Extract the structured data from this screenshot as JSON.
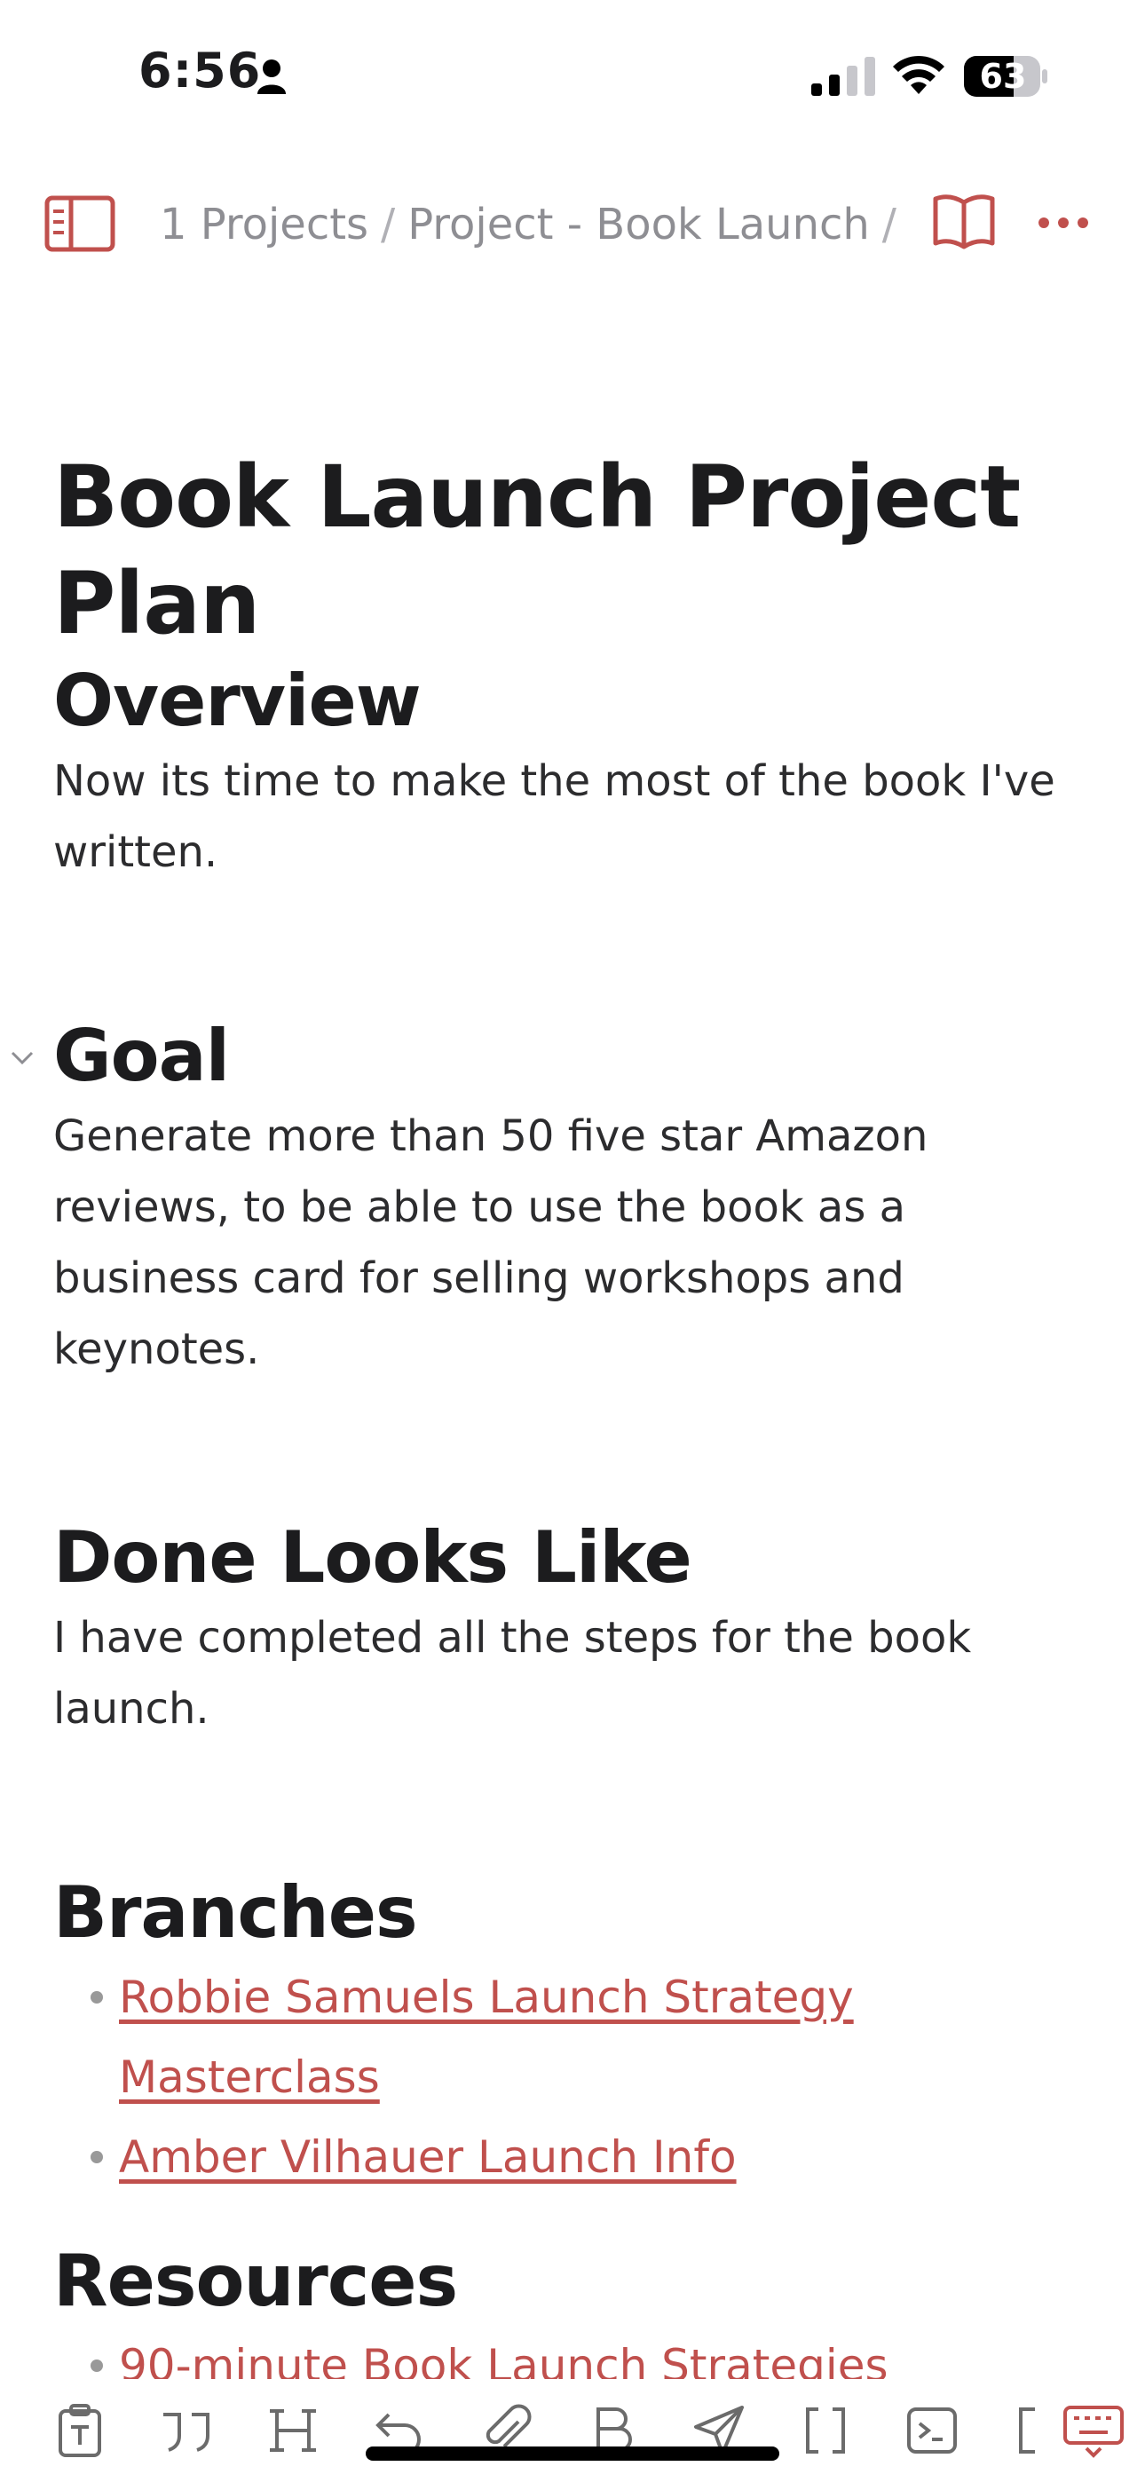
{
  "status_bar": {
    "time": "6:56",
    "battery": "63"
  },
  "toolbar": {
    "breadcrumb": [
      "1 Projects",
      "Project - Book Launch",
      "_"
    ]
  },
  "document": {
    "title": "Book Launch Project Plan",
    "sections": [
      {
        "heading": "Overview",
        "body": "Now its time to make the most of the book I've written."
      },
      {
        "heading": "Goal",
        "body": "Generate more than 50 five star Amazon reviews, to be able to use the book as a business card for selling workshops and keynotes."
      },
      {
        "heading": "Done Looks Like",
        "body": "I have completed all the steps for the book launch."
      },
      {
        "heading": "Branches",
        "links": [
          "Robbie Samuels Launch Strategy Masterclass",
          "Amber Vilhauer Launch Info"
        ]
      },
      {
        "heading": "Resources",
        "links": [
          "90-minute Book Launch Strategies"
        ]
      }
    ]
  },
  "colors": {
    "accent": "#c0504d",
    "text": "#1c1c1e",
    "muted": "#8e8e93"
  },
  "format_bar": {
    "icons": [
      "template-icon",
      "quote-icon",
      "heading-icon",
      "undo-icon",
      "attachment-icon",
      "bold-icon",
      "send-icon",
      "brackets-icon",
      "terminal-icon",
      "bracket-partial-icon",
      "keyboard-dismiss-icon"
    ]
  }
}
